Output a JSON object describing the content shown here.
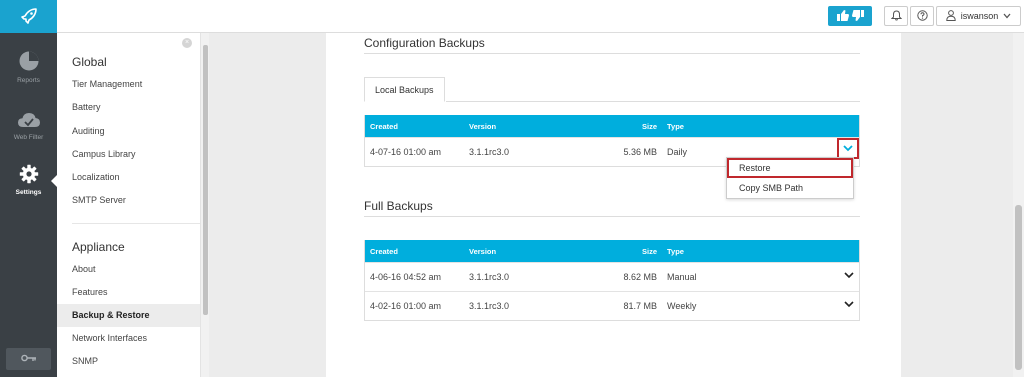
{
  "header": {
    "username": "iswanson",
    "icons": [
      "rocket-icon",
      "thumbs-up-icon",
      "thumbs-down-icon",
      "bell-icon",
      "help-icon",
      "user-icon",
      "chevron-down-icon"
    ]
  },
  "sidenav": {
    "items": [
      {
        "label": "Reports",
        "icon": "pie-chart-icon"
      },
      {
        "label": "Web Filter",
        "icon": "cloud-icon"
      },
      {
        "label": "Settings",
        "icon": "gear-icon"
      }
    ],
    "key_icon": "key-icon"
  },
  "submenu": {
    "global_title": "Global",
    "global_items": [
      "Tier Management",
      "Battery",
      "Auditing",
      "Campus Library",
      "Localization",
      "SMTP Server"
    ],
    "appliance_title": "Appliance",
    "appliance_items": [
      "About",
      "Features",
      "Backup & Restore",
      "Network Interfaces",
      "SNMP"
    ],
    "active_item": "Backup & Restore"
  },
  "config_backups": {
    "title": "Configuration Backups",
    "tab_label": "Local Backups",
    "columns": {
      "created": "Created",
      "version": "Version",
      "size": "Size",
      "type": "Type"
    },
    "rows": [
      {
        "created": "4-07-16 01:00 am",
        "version": "3.1.1rc3.0",
        "size": "5.36 MB",
        "type": "Daily"
      }
    ],
    "menu": {
      "restore": "Restore",
      "copy_smb": "Copy SMB Path"
    }
  },
  "full_backups": {
    "title": "Full Backups",
    "columns": {
      "created": "Created",
      "version": "Version",
      "size": "Size",
      "type": "Type"
    },
    "rows": [
      {
        "created": "4-06-16 04:52 am",
        "version": "3.1.1rc3.0",
        "size": "8.62 MB",
        "type": "Manual"
      },
      {
        "created": "4-02-16 01:00 am",
        "version": "3.1.1rc3.0",
        "size": "81.7 MB",
        "type": "Weekly"
      }
    ]
  },
  "colors": {
    "brand": "#1aa3cf",
    "table_header": "#00aedd",
    "sidebar": "#3a4045",
    "highlight": "#c0282d"
  }
}
